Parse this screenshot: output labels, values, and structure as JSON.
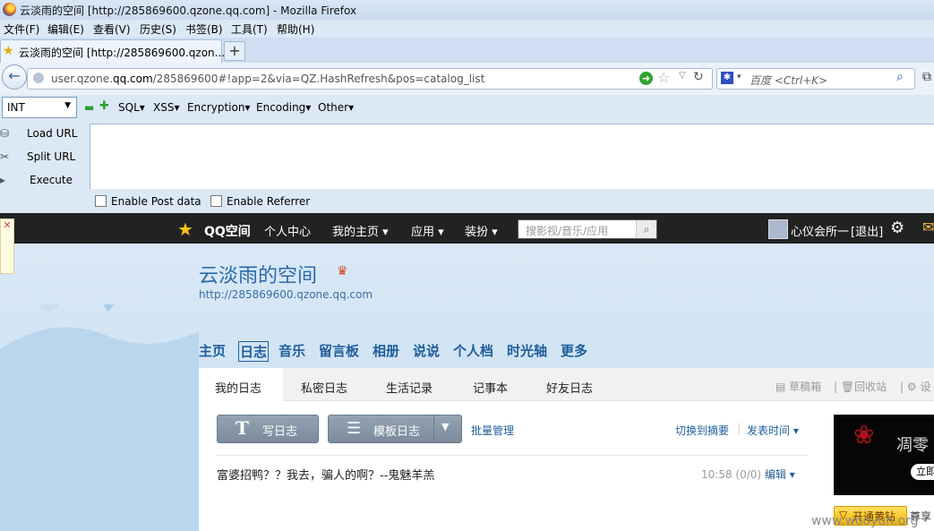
{
  "window": {
    "title": "云淡雨的空间 [http://285869600.qzone.qq.com] - Mozilla Firefox"
  },
  "menubar": [
    "文件(F)",
    "编辑(E)",
    "查看(V)",
    "历史(S)",
    "书签(B)",
    "工具(T)",
    "帮助(H)"
  ],
  "tab": {
    "title": "云淡雨的空间 [http://285869600.qzon...",
    "new_tab": "+"
  },
  "navbar": {
    "url_prefix": "user.qzone.",
    "url_domain": "qq.com",
    "url_rest": "/285869600#!app=2&via=QZ.HashRefresh&pos=catalog_list",
    "search_placeholder": "百度 <Ctrl+K>"
  },
  "hackbar": {
    "type_select": "INT",
    "menus": [
      "SQL▾",
      "XSS▾",
      "Encryption▾",
      "Encoding▾",
      "Other▾"
    ],
    "side": [
      "Load URL",
      "Split URL",
      "Execute"
    ],
    "checkboxes": [
      "Enable Post data",
      "Enable Referrer"
    ]
  },
  "qzone": {
    "logo": "QQ空间",
    "topnav": [
      "个人中心",
      "我的主页 ▾",
      "应用 ▾",
      "装扮 ▾"
    ],
    "search_placeholder": "搜影视/音乐/应用",
    "user": "心仪会所一",
    "logout": "[退出]",
    "space_title": "云淡雨的空间",
    "space_url": "http://285869600.qzone.qq.com",
    "mainnav": [
      "主页",
      "日志",
      "音乐",
      "留言板",
      "相册",
      "说说",
      "个人档",
      "时光轴",
      "更多"
    ],
    "subtabs": [
      "我的日志",
      "私密日志",
      "生活记录",
      "记事本",
      "好友日志"
    ],
    "subtab_right": [
      "草稿箱",
      "回收站",
      "设"
    ],
    "write_btn": "写日志",
    "template_btn": "模板日志",
    "batch": "批量管理",
    "switch_summary": "切换到摘要",
    "publish_time": "发表时间 ▾",
    "post": {
      "title": "富婆招鸭？？我去，骗人的啊？--鬼魅羊羔",
      "time": "10:58",
      "count": "(0/0)",
      "edit": "编辑 ▾"
    },
    "ad_text": "凋零",
    "ad_tag": "立即",
    "vip_btn": "开通黄钻",
    "vip_tail": "尊享"
  },
  "watermark": "www.wooyun.org"
}
